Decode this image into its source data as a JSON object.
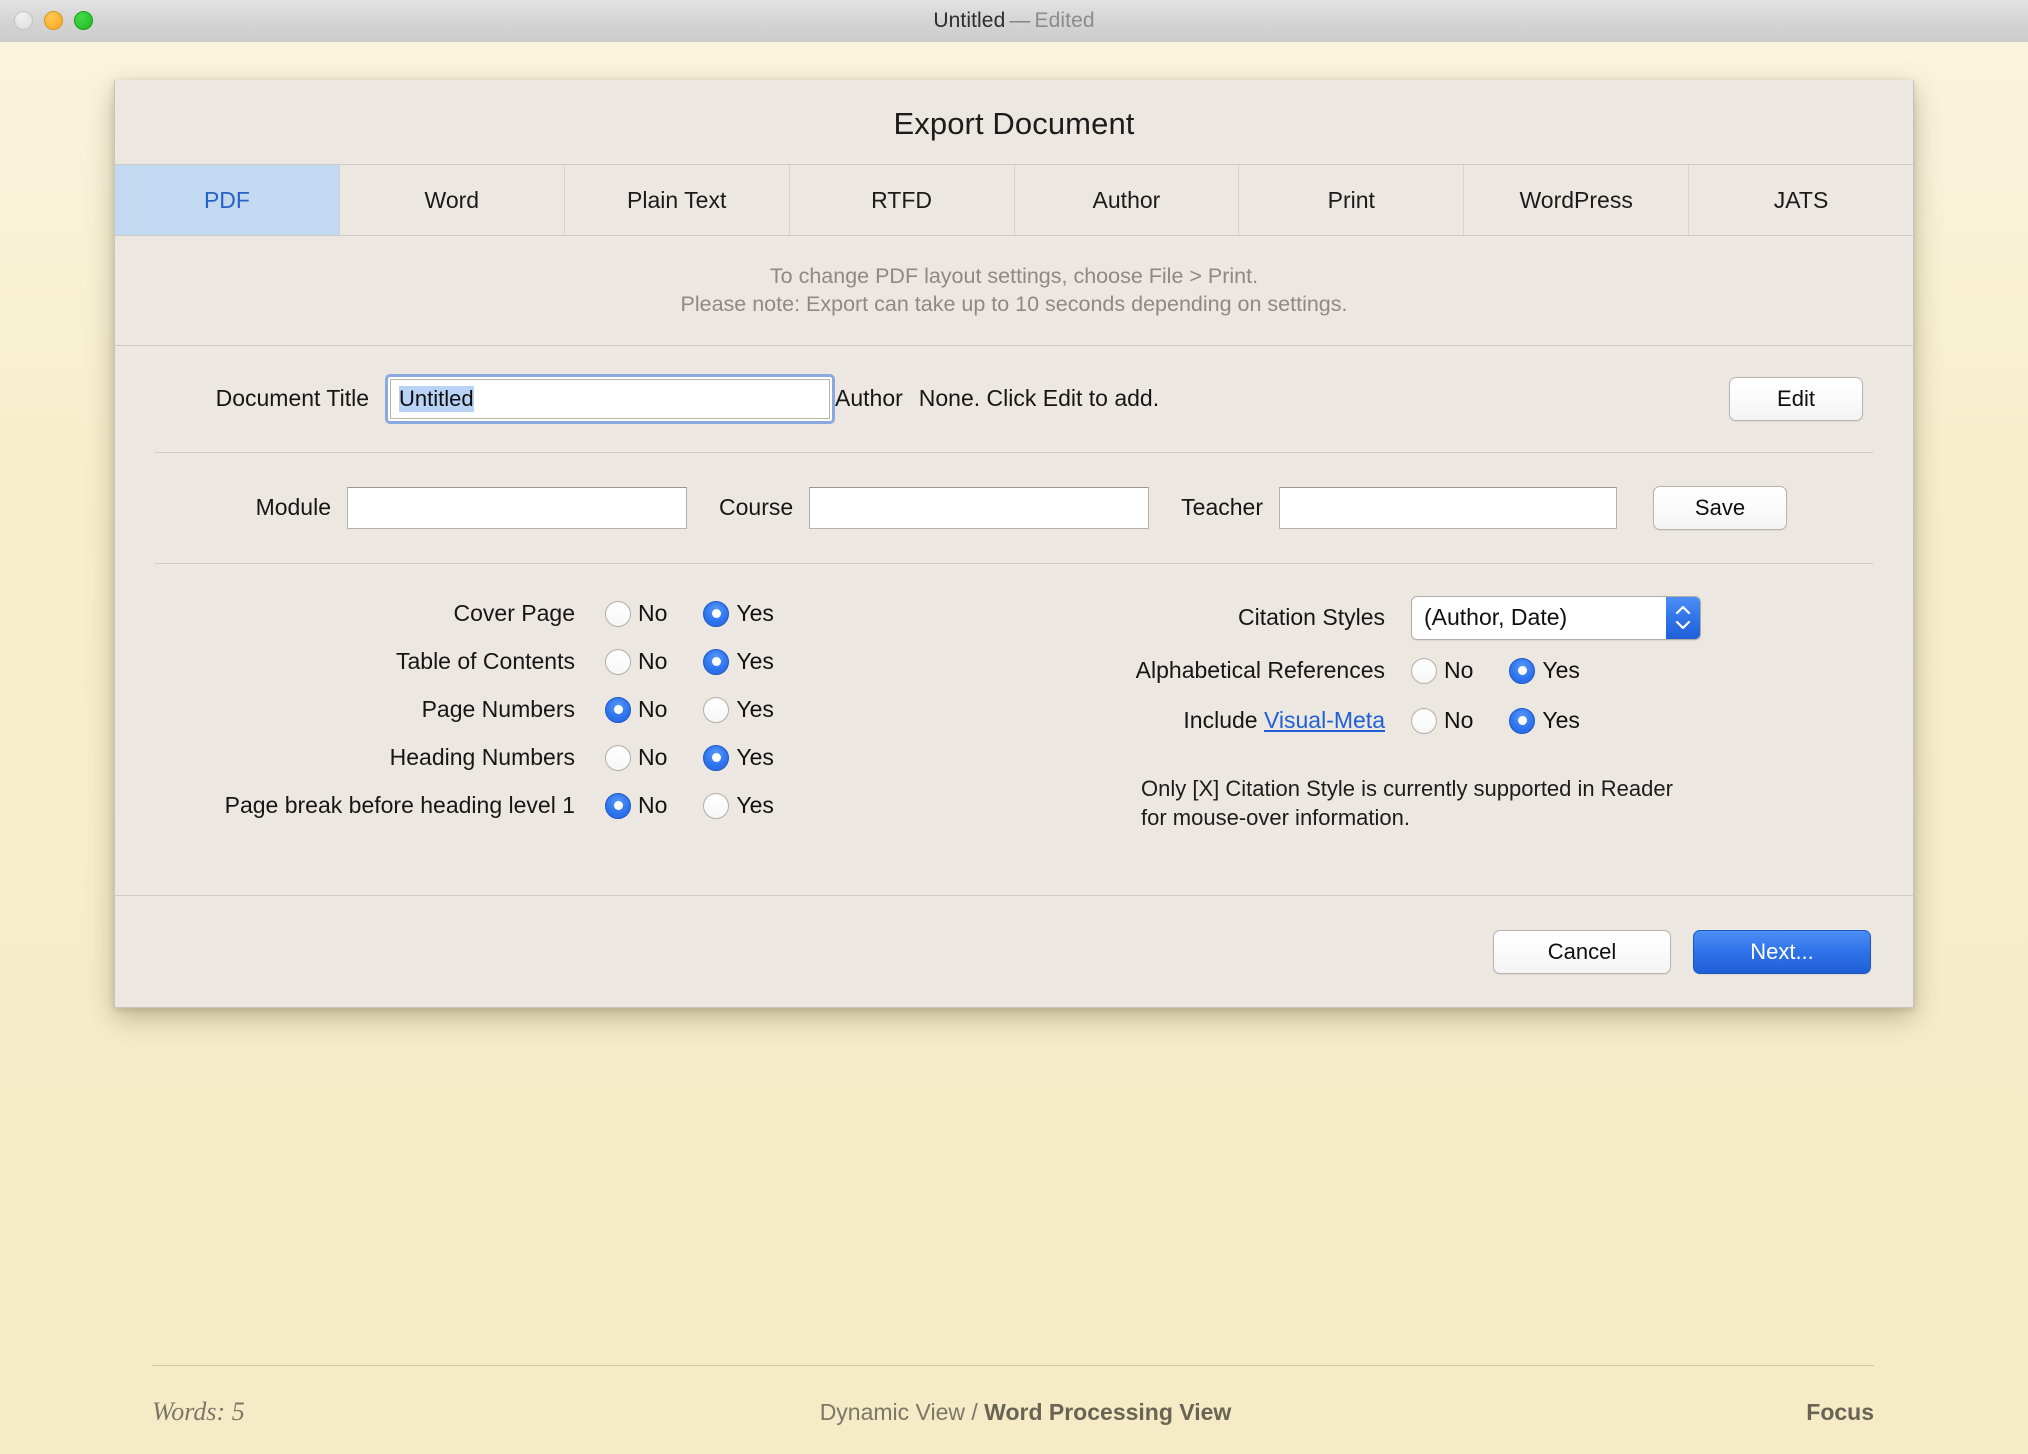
{
  "window": {
    "title_main": "Untitled",
    "title_dash": "—",
    "title_state": "Edited",
    "traffic": {
      "close": "close-button",
      "minimize": "minimize-button",
      "maximize": "maximize-button"
    }
  },
  "dialog": {
    "title": "Export Document",
    "tabs": [
      {
        "label": "PDF",
        "active": true
      },
      {
        "label": "Word",
        "active": false
      },
      {
        "label": "Plain Text",
        "active": false
      },
      {
        "label": "RTFD",
        "active": false
      },
      {
        "label": "Author",
        "active": false
      },
      {
        "label": "Print",
        "active": false
      },
      {
        "label": "WordPress",
        "active": false
      },
      {
        "label": "JATS",
        "active": false
      }
    ],
    "info_line1": "To change PDF layout settings, choose File > Print.",
    "info_line2": "Please note: Export can take up to 10 seconds depending on settings.",
    "document_title": {
      "label": "Document Title",
      "value": "Untitled",
      "placeholder": ""
    },
    "author": {
      "label": "Author",
      "value": "None. Click Edit to add.",
      "edit_button": "Edit"
    },
    "metadata": {
      "module_label": "Module",
      "module_value": "",
      "module_placeholder": "",
      "course_label": "Course",
      "course_value": "",
      "course_placeholder": "",
      "teacher_label": "Teacher",
      "teacher_value": "",
      "teacher_placeholder": "",
      "save_button": "Save"
    },
    "options_left": [
      {
        "label": "Cover Page",
        "no": "No",
        "yes": "Yes",
        "selected": "yes"
      },
      {
        "label": "Table of Contents",
        "no": "No",
        "yes": "Yes",
        "selected": "yes"
      },
      {
        "label": "Page Numbers",
        "no": "No",
        "yes": "Yes",
        "selected": "no"
      },
      {
        "label": "Heading Numbers",
        "no": "No",
        "yes": "Yes",
        "selected": "yes"
      },
      {
        "label": "Page break before heading level 1",
        "no": "No",
        "yes": "Yes",
        "selected": "no"
      }
    ],
    "citation": {
      "label": "Citation Styles",
      "value": "(Author, Date)",
      "options": [
        "(Author, Date)"
      ]
    },
    "options_right": [
      {
        "label": "Alphabetical References",
        "label_link": "",
        "no": "No",
        "yes": "Yes",
        "selected": "yes"
      },
      {
        "label_prefix": "Include ",
        "label_link": "Visual-Meta",
        "no": "No",
        "yes": "Yes",
        "selected": "yes"
      }
    ],
    "right_note_line1": "Only [X] Citation Style is currently supported in Reader",
    "right_note_line2": "for mouse-over information.",
    "cancel_button": "Cancel",
    "next_button": "Next..."
  },
  "doc_footer": {
    "words": "Words: 5",
    "view_dynamic": "Dynamic View",
    "view_sep": " / ",
    "view_current": "Word Processing View",
    "focus": "Focus"
  },
  "colors": {
    "accent_blue": "#2f72e8",
    "tab_active_bg": "#c3d9f2",
    "tab_active_text": "#2862c4",
    "sheet_bg": "#ece8e1",
    "paper_bg": "#f5ebc8",
    "link": "#1f5fd8"
  }
}
